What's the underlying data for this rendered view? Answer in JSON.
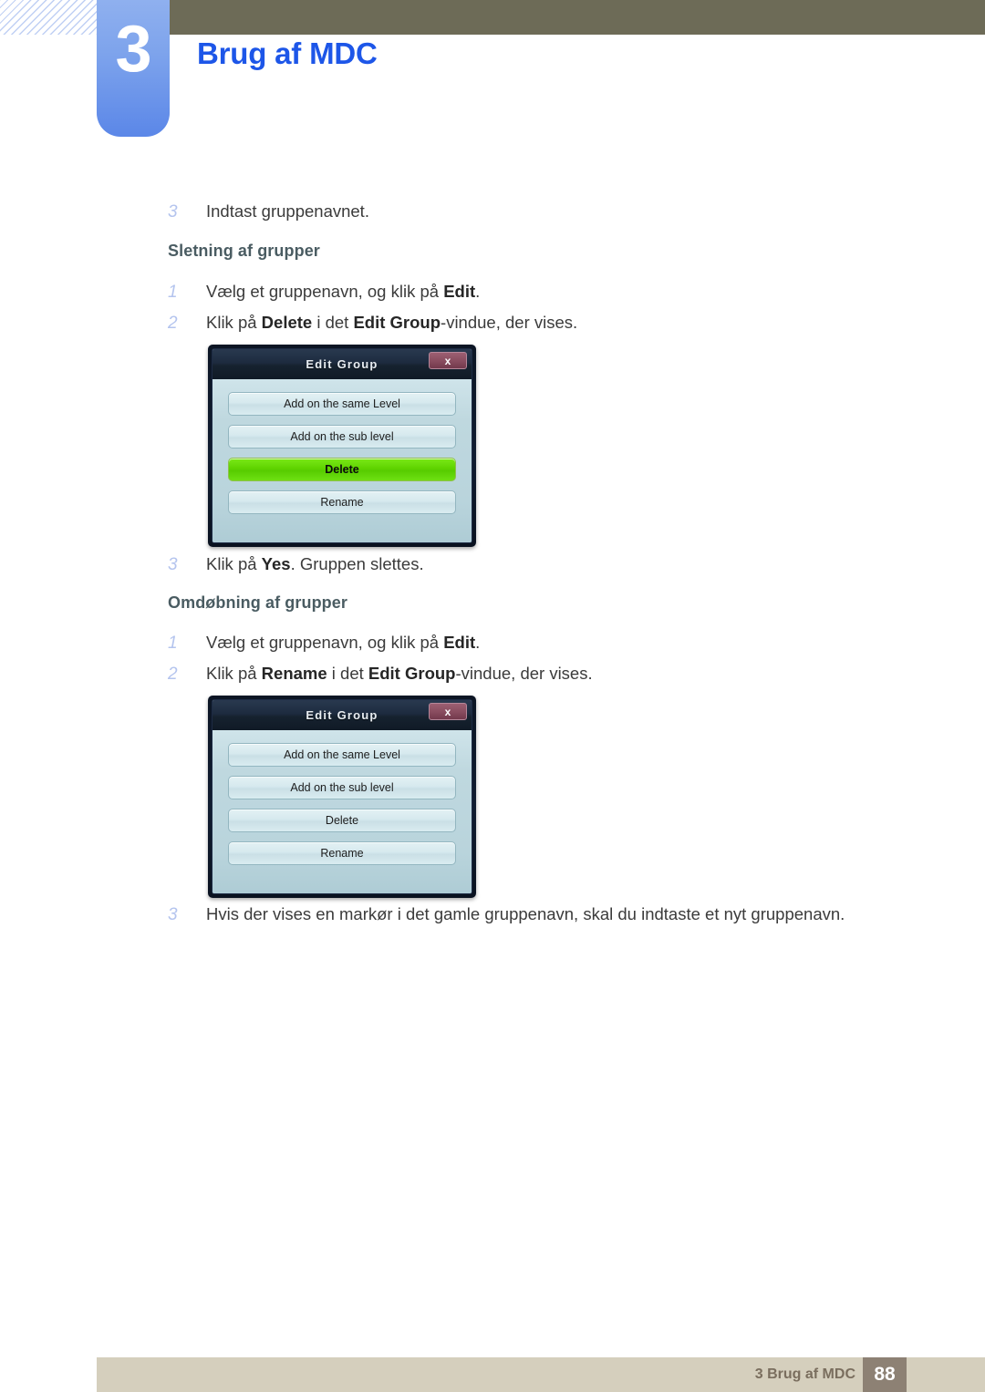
{
  "header": {
    "chapter_number": "3",
    "chapter_title": "Brug af MDC",
    "accent_blue": "#1d56e8",
    "tab_blue": "#7da3ec",
    "olive": "#6d6b57"
  },
  "content": {
    "step_intro": {
      "num": "3",
      "text": "Indtast gruppenavnet."
    },
    "section_delete": {
      "heading": "Sletning af grupper",
      "steps": [
        {
          "num": "1",
          "parts": [
            {
              "t": "Vælg et gruppenavn, og klik på ",
              "b": false
            },
            {
              "t": "Edit",
              "b": true
            },
            {
              "t": ".",
              "b": false
            }
          ]
        },
        {
          "num": "2",
          "parts": [
            {
              "t": "Klik på ",
              "b": false
            },
            {
              "t": "Delete",
              "b": true
            },
            {
              "t": " i det ",
              "b": false
            },
            {
              "t": "Edit Group",
              "b": true
            },
            {
              "t": "-vindue, der vises.",
              "b": false
            }
          ]
        }
      ],
      "step_after": {
        "num": "3",
        "parts": [
          {
            "t": "Klik på ",
            "b": false
          },
          {
            "t": "Yes",
            "b": true
          },
          {
            "t": ". Gruppen slettes.",
            "b": false
          }
        ]
      }
    },
    "section_rename": {
      "heading": "Omdøbning af grupper",
      "steps": [
        {
          "num": "1",
          "parts": [
            {
              "t": "Vælg et gruppenavn, og klik på ",
              "b": false
            },
            {
              "t": "Edit",
              "b": true
            },
            {
              "t": ".",
              "b": false
            }
          ]
        },
        {
          "num": "2",
          "parts": [
            {
              "t": "Klik på ",
              "b": false
            },
            {
              "t": "Rename",
              "b": true
            },
            {
              "t": " i det ",
              "b": false
            },
            {
              "t": "Edit Group",
              "b": true
            },
            {
              "t": "-vindue, der vises.",
              "b": false
            }
          ]
        }
      ],
      "step_after": {
        "num": "3",
        "parts": [
          {
            "t": "Hvis der vises en markør i det gamle gruppenavn, skal du indtaste et nyt gruppenavn.",
            "b": false
          }
        ]
      }
    }
  },
  "dialog_delete": {
    "title": "Edit Group",
    "close_label": "x",
    "buttons": [
      {
        "label": "Add on the same Level",
        "highlighted": false
      },
      {
        "label": "Add on the sub level",
        "highlighted": false
      },
      {
        "label": "Delete",
        "highlighted": true
      },
      {
        "label": "Rename",
        "highlighted": false
      }
    ],
    "highlight_color": "#5fd400"
  },
  "dialog_rename": {
    "title": "Edit Group",
    "close_label": "x",
    "buttons": [
      {
        "label": "Add on the same Level",
        "highlighted": false
      },
      {
        "label": "Add on the sub level",
        "highlighted": false
      },
      {
        "label": "Delete",
        "highlighted": false
      },
      {
        "label": "Rename",
        "highlighted": false
      }
    ],
    "highlight_color": "#5fd400"
  },
  "footer": {
    "label": "3 Brug af MDC",
    "page_number": "88",
    "bar_color": "#d5cfbd",
    "page_box_color": "#8d8174"
  }
}
